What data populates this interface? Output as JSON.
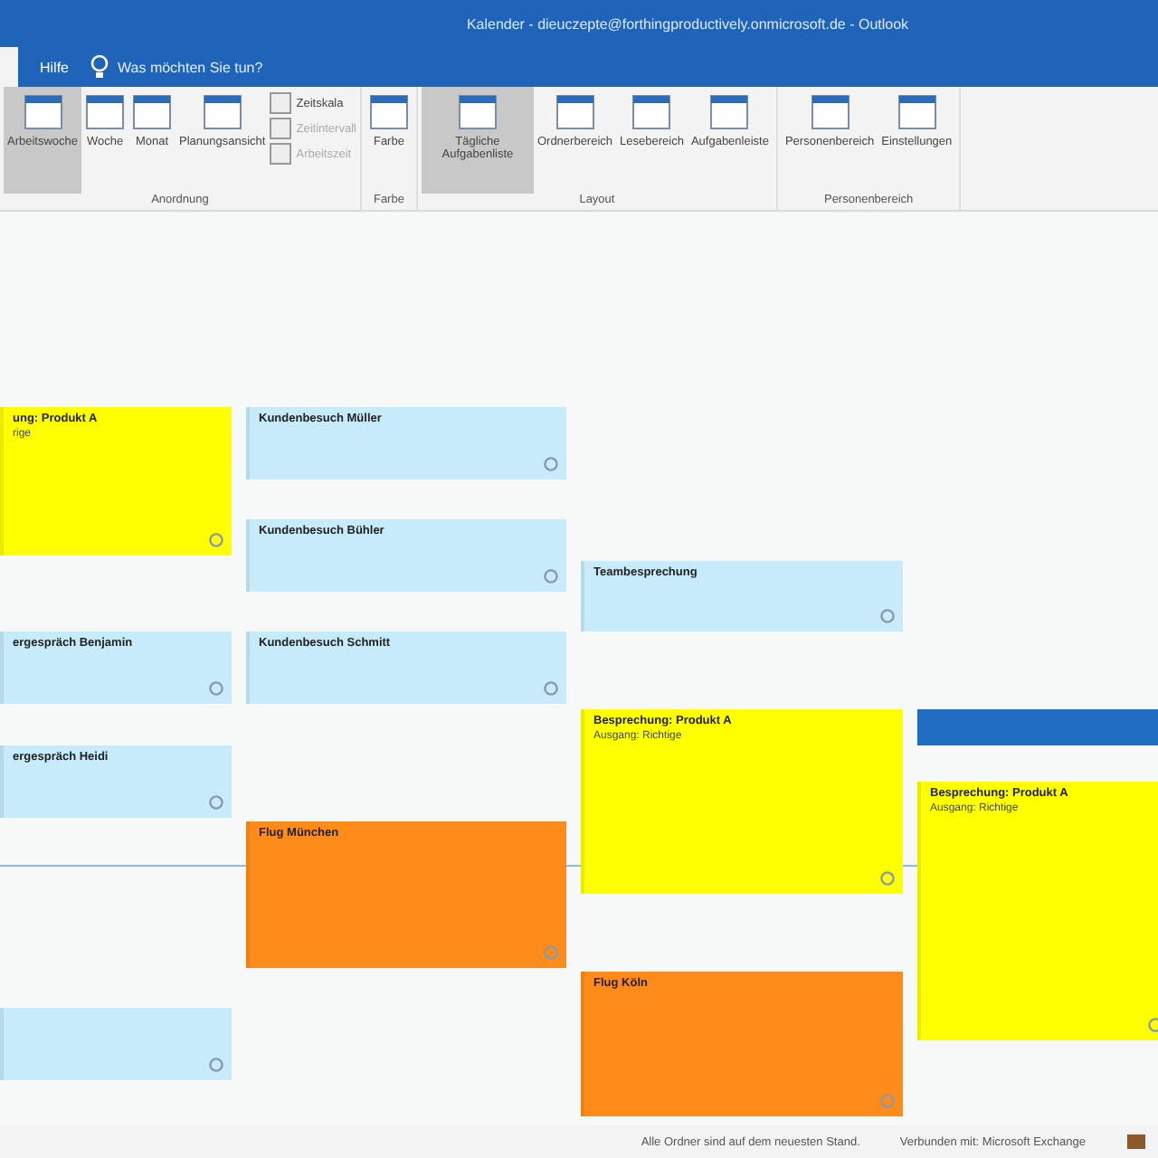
{
  "window": {
    "title": "Kalender - dieuczepte@forthingproductively.onmicrosoft.de - Outlook"
  },
  "tabs": [
    {
      "label": "Hilfe",
      "selected": false
    }
  ],
  "tell_me": {
    "placeholder": "Was möchten Sie tun?"
  },
  "ribbon": {
    "groups": [
      {
        "label": "Anordnung",
        "buttons": [
          {
            "label": "Arbeitswoche",
            "selected": true
          },
          {
            "label": "Woche",
            "selected": false
          },
          {
            "label": "Monat",
            "selected": false
          },
          {
            "label": "Planungsansicht",
            "selected": false
          }
        ],
        "small": [
          {
            "label": "Zeitskala",
            "disabled": false
          },
          {
            "label": "Zeitintervall",
            "disabled": true
          },
          {
            "label": "Arbeitszeit",
            "disabled": true
          }
        ]
      },
      {
        "label": "Farbe",
        "buttons": [
          {
            "label": "Farbe",
            "selected": false
          }
        ]
      },
      {
        "label": "Layout",
        "buttons": [
          {
            "label": "Tägliche Aufgabenliste",
            "selected": true
          },
          {
            "label": "Ordnerbereich",
            "selected": false
          },
          {
            "label": "Lesebereich",
            "selected": false
          },
          {
            "label": "Aufgabenleiste",
            "selected": false
          }
        ]
      },
      {
        "label": "Personenbereich",
        "buttons": [
          {
            "label": "Personenbereich",
            "selected": false
          },
          {
            "label": "Einstellungen",
            "selected": false
          }
        ]
      }
    ]
  },
  "days": [
    {
      "events": [
        {
          "title": "ung: Produkt A",
          "subtitle": "rige",
          "color": "#ffff00"
        },
        {
          "title": "ergespräch Benjamin",
          "color": "#c7ebfa"
        },
        {
          "title": "ergespräch Heidi",
          "color": "#c7ebfa"
        },
        {
          "color": "#c7ebfa"
        }
      ]
    },
    {
      "events": [
        {
          "title": "Kundenbesuch Müller",
          "color": "#c7ebfa"
        },
        {
          "title": "Kundenbesuch Bühler",
          "color": "#c7ebfa"
        },
        {
          "title": "Kundenbesuch Schmitt",
          "color": "#c7ebfa"
        },
        {
          "title": "Flug München",
          "color": "#ff8c1a"
        }
      ]
    },
    {
      "events": [
        {
          "title": "Teambesprechung",
          "color": "#c7ebfa"
        },
        {
          "title": "Besprechung: Produkt A",
          "subtitle": "Ausgang: Richtige",
          "color": "#ffff00"
        },
        {
          "title": "Flug Köln",
          "color": "#ff8c1a"
        }
      ]
    },
    {
      "events": [
        {
          "title": "Besprechung: Produkt A",
          "subtitle": "Ausgang: Richtige",
          "color": "#ffff00"
        }
      ]
    }
  ],
  "status_bar": {
    "left": "Alle Ordner sind auf dem neuesten Stand.",
    "right": "Verbunden mit: Microsoft Exchange"
  }
}
